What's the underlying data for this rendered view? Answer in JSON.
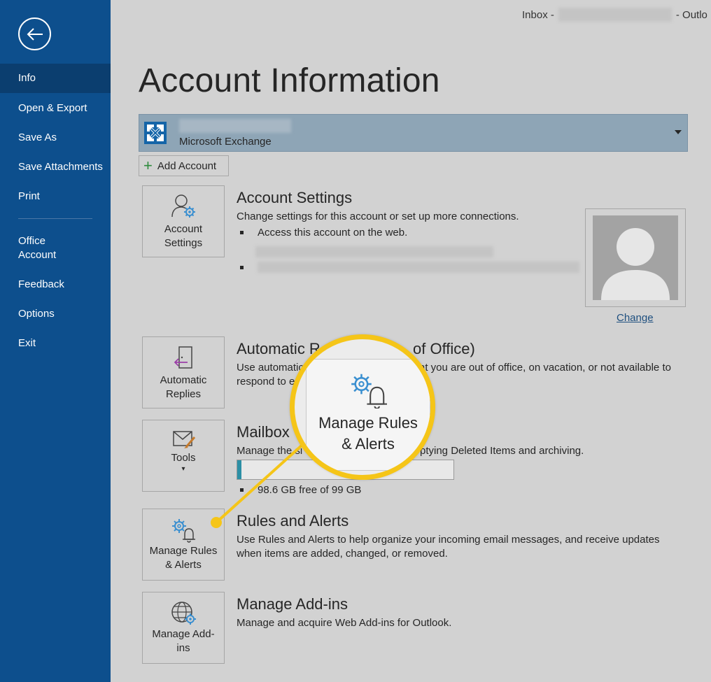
{
  "window": {
    "title_prefix": "Inbox -",
    "title_suffix": "-  Outlo"
  },
  "sidebar": {
    "items": [
      {
        "label": "Info"
      },
      {
        "label": "Open & Export"
      },
      {
        "label": "Save As"
      },
      {
        "label": "Save Attachments"
      },
      {
        "label": "Print"
      },
      {
        "label": "Office\nAccount"
      },
      {
        "label": "Feedback"
      },
      {
        "label": "Options"
      },
      {
        "label": "Exit"
      }
    ]
  },
  "page": {
    "title": "Account Information"
  },
  "account": {
    "type": "Microsoft Exchange",
    "add_label": "Add Account"
  },
  "account_settings": {
    "tile_label": "Account\nSettings",
    "title": "Account Settings",
    "desc": "Change settings for this account or set up more connections.",
    "bullet1": "Access this account on the web.",
    "change_label": "Change"
  },
  "auto_replies": {
    "tile_label": "Automatic\nReplies",
    "title": "Automatic R",
    "title_tail": "of Office)",
    "desc_a": "Use automatic",
    "desc_b": "at you are out of office, on vacation, or not available to",
    "desc_c": "respond to e"
  },
  "mailbox": {
    "tile_label": "Tools",
    "title": "Mailbox",
    "desc_a": "Manage the si",
    "desc_b": "ptying Deleted Items and archiving.",
    "usage_label": "98.6 GB free of 99 GB",
    "used_fraction": 0.02
  },
  "rules": {
    "tile_label": "Manage Rules\n& Alerts",
    "title": "Rules and Alerts",
    "desc": "Use Rules and Alerts to help organize your incoming email messages, and receive updates when items are added, changed, or removed."
  },
  "addins": {
    "tile_label": "Manage Add-\nins",
    "title": "Manage Add-ins",
    "desc": "Manage and acquire Web Add-ins for Outlook."
  },
  "callout": {
    "label_line1": "Manage Rules",
    "label_line2": "& Alerts",
    "ring_color": "#f5c518"
  },
  "colors": {
    "sidebar": "#0d4f8d",
    "sidebar_active": "#0b3e6f",
    "background": "#d2d2d2",
    "accent_icon": "#3a8fd0"
  },
  "icons": [
    "back-arrow-icon",
    "exchange-icon",
    "plus-icon",
    "account-settings-icon",
    "door-arrow-icon",
    "mail-tools-icon",
    "gear-bell-icon",
    "globe-gear-icon",
    "person-silhouette-icon"
  ]
}
